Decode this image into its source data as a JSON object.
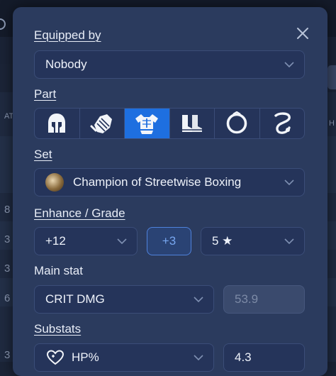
{
  "modal": {
    "equipped_by": {
      "label": "Equipped by",
      "value": "Nobody"
    },
    "part": {
      "label": "Part",
      "options": [
        "helmet-icon",
        "gloves-icon",
        "chest-armor-icon",
        "boots-icon",
        "ring-icon",
        "necklace-icon"
      ],
      "selected": "chest-armor-icon"
    },
    "set": {
      "label": "Set",
      "value": "Champion of Streetwise Boxing",
      "icon": "set-emblem-icon"
    },
    "enhance": {
      "label": "Enhance / Grade",
      "level": "+12",
      "bonus": "+3",
      "grade": "5 ★"
    },
    "main_stat": {
      "label": "Main stat",
      "name": "CRIT DMG",
      "value": "53.9"
    },
    "substats": {
      "label": "Substats",
      "rows": [
        {
          "icon": "hp-heart-icon",
          "name": "HP%",
          "value": "4.3"
        }
      ]
    }
  },
  "background": {
    "left_digits": [
      "8",
      "3",
      "3",
      "6",
      "3"
    ],
    "left_header": "AT",
    "right_header": "H"
  },
  "colors": {
    "modal_bg": "#2b3b5e",
    "field_bg": "#25345a",
    "accent": "#1e6fe0",
    "accent_text": "#78a7f0"
  }
}
